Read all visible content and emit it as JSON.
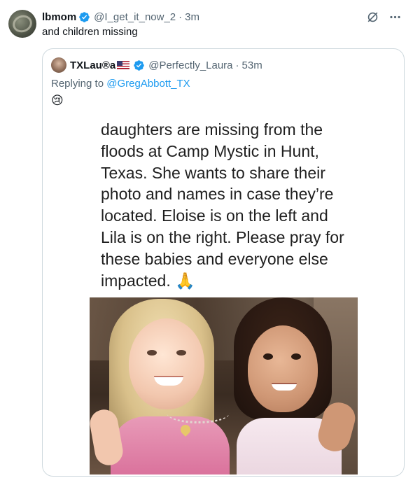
{
  "tweet": {
    "author_name": "lbmom",
    "handle": "@I_get_it_now_2",
    "time": "3m",
    "separator": "·",
    "text": "and children missing"
  },
  "quote": {
    "author_name": "TXLau®a",
    "handle": "@Perfectly_Laura",
    "time": "53m",
    "separator": "·",
    "reply_prefix": "Replying to ",
    "reply_to": "@GregAbbott_TX",
    "emoji": "😢",
    "image_text": "daughters are missing from the floods at Camp Mystic in Hunt, Texas. She wants to share their photo and names in case they’re located. Eloise is on the left and Lila is on the right. Please pray for these babies and everyone else impacted.",
    "image_text_emoji": "🙏"
  },
  "icons": {
    "verified": "verified-badge-icon",
    "grok": "grok-slash-icon",
    "more": "more-options-icon"
  },
  "colors": {
    "verified": "#1d9bf0",
    "link": "#1d9bf0",
    "muted": "#536471",
    "border": "#cfd9de"
  }
}
